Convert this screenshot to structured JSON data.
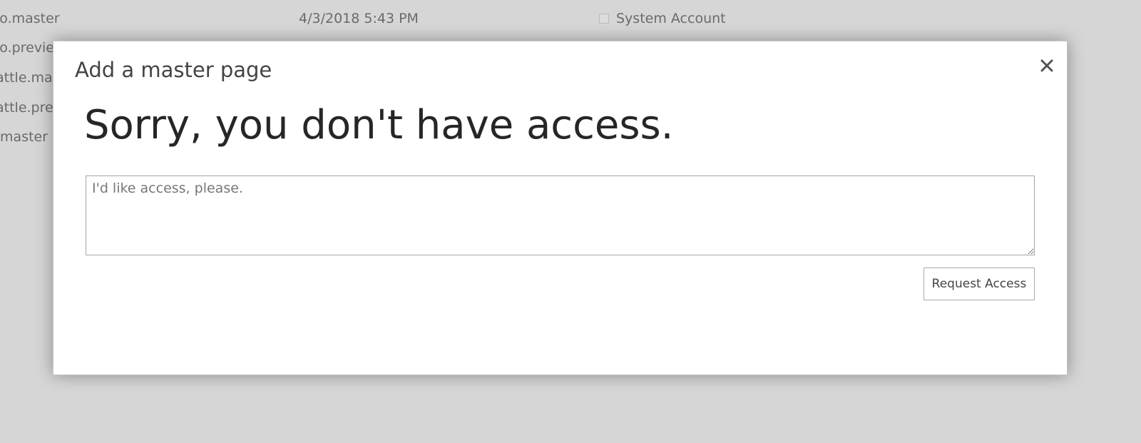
{
  "background_list": {
    "rows": [
      {
        "name": "lo.master",
        "date": "4/3/2018 5:43 PM",
        "author": "System Account"
      },
      {
        "name": "lo.previe"
      },
      {
        "name": "attle.ma"
      },
      {
        "name": "attle.pre"
      },
      {
        "name": ".master"
      }
    ]
  },
  "dialog": {
    "title": "Add a master page",
    "close_icon": "close-icon",
    "heading": "Sorry, you don't have access.",
    "message_placeholder": "I'd like access, please.",
    "message_value": "",
    "request_button_label": "Request Access"
  }
}
